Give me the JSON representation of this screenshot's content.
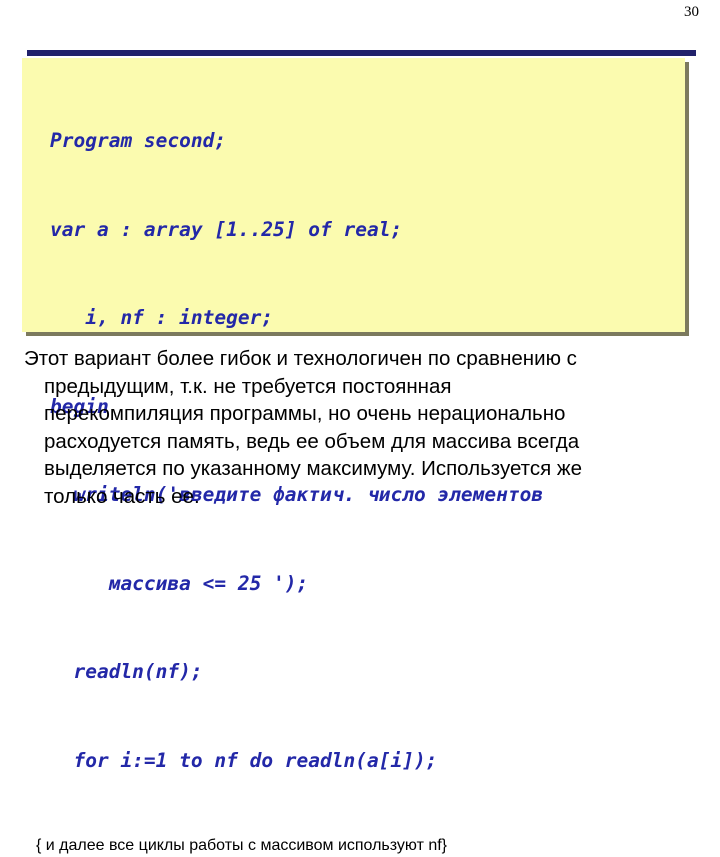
{
  "slide": {
    "page_number": "30",
    "accent_color": "#21216b",
    "code_box_bg": "#fbfbaf",
    "code_text_color": "#2328a8",
    "body_text_color": "#000000"
  },
  "code_block": {
    "lines": [
      "Program second;",
      "var a : array [1..25] of real;",
      "   i, nf : integer;",
      "begin",
      "  writeln('введите фактич. число элементов",
      "     массива <= 25 ');",
      "  readln(nf);",
      "  for i:=1 to nf do readln(a[i]);"
    ],
    "comment": "{ и далее все циклы работы с массивом используют nf}"
  },
  "body": {
    "lines": [
      "Этот вариант более гибок и технологичен по сравнению с",
      "предыдущим, т.к. не требуется постоянная",
      "перекомпиляция программы, но очень нерационально",
      "расходуется память, ведь ее объем для массива всегда",
      "выделяется по указанному максимуму. Используется же",
      "только часть ее."
    ]
  }
}
